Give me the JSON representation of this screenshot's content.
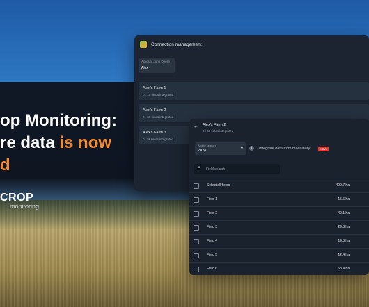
{
  "headline": {
    "line1": "op Monitoring:",
    "line2_white": "re data ",
    "line2_accent": "is now",
    "line3_accent": "d"
  },
  "logo": {
    "brand": "CROP",
    "sub": "monitoring"
  },
  "connection": {
    "title": "Connection management",
    "account_label": "Account John Deere",
    "account_value": "Alex",
    "farms": [
      {
        "name": "Alex's Farm 1",
        "status": "0 / 10 fields integrated"
      },
      {
        "name": "Alex's Farm 2",
        "status": "0 / 60 fields integrated"
      },
      {
        "name": "Alex's Farm 3",
        "status": "0 / 5k fields integrated"
      }
    ]
  },
  "farm_detail": {
    "title": "Alex's Farm 2",
    "subtitle": "0 / 60 fields integrated",
    "season_label": "Add to season",
    "season_value": "2024",
    "integrate_label": "Integrate data from machinary",
    "new_badge": "NEW",
    "search_placeholder": "Field search",
    "select_all": {
      "name": "Select all fields",
      "value": "499.7 ha"
    },
    "fields": [
      {
        "name": "Field 1",
        "value": "15.5 ha"
      },
      {
        "name": "Field 2",
        "value": "40.1 ha"
      },
      {
        "name": "Field 3",
        "value": "29.6 ha"
      },
      {
        "name": "Field 4",
        "value": "19.3 ha"
      },
      {
        "name": "Field 5",
        "value": "12.4 ha"
      },
      {
        "name": "Field 6",
        "value": "68.4 ha"
      }
    ]
  },
  "colors": {
    "accent": "#f28a2f",
    "panel": "#1b2430"
  },
  "icons": {
    "back": "arrow-left-icon",
    "search": "search-icon",
    "chevron": "chevron-down-icon",
    "info": "info-icon",
    "logo": "leaf-logo-icon"
  }
}
